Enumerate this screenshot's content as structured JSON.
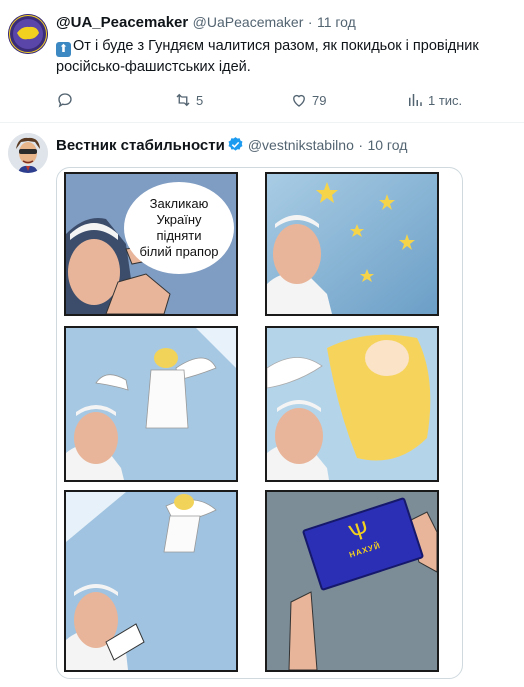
{
  "tweet1": {
    "display_name": "@UA_Peacemaker",
    "handle": "@UaPeacemaker",
    "separator": "·",
    "time": "11 год",
    "text": "От і буде з Гундяєм чалитися разом, як покидьок і провідник російсько-фашистських ідей.",
    "prefix_icon": "up-arrow-icon",
    "actions": {
      "reply_icon": "reply-icon",
      "retweet_icon": "retweet-icon",
      "retweet_count": "5",
      "like_icon": "heart-icon",
      "like_count": "79",
      "views_icon": "views-icon",
      "views_count": "1 тис."
    }
  },
  "tweet2": {
    "display_name": "Вестник стабильности",
    "verified_icon": "verified-badge-icon",
    "handle": "@vestnikstabilno",
    "separator": "·",
    "time": "10 год",
    "comic": {
      "speech_bubble": [
        "Закликаю",
        "Україну",
        "підняти",
        "білий прапор"
      ],
      "document_text": "НАХУЙ"
    }
  },
  "colors": {
    "accent": "#1d9bf0",
    "muted_text": "#536471",
    "divider": "#eff3f4",
    "document_blue": "#2a2fb5",
    "document_gold": "#f2d020"
  }
}
